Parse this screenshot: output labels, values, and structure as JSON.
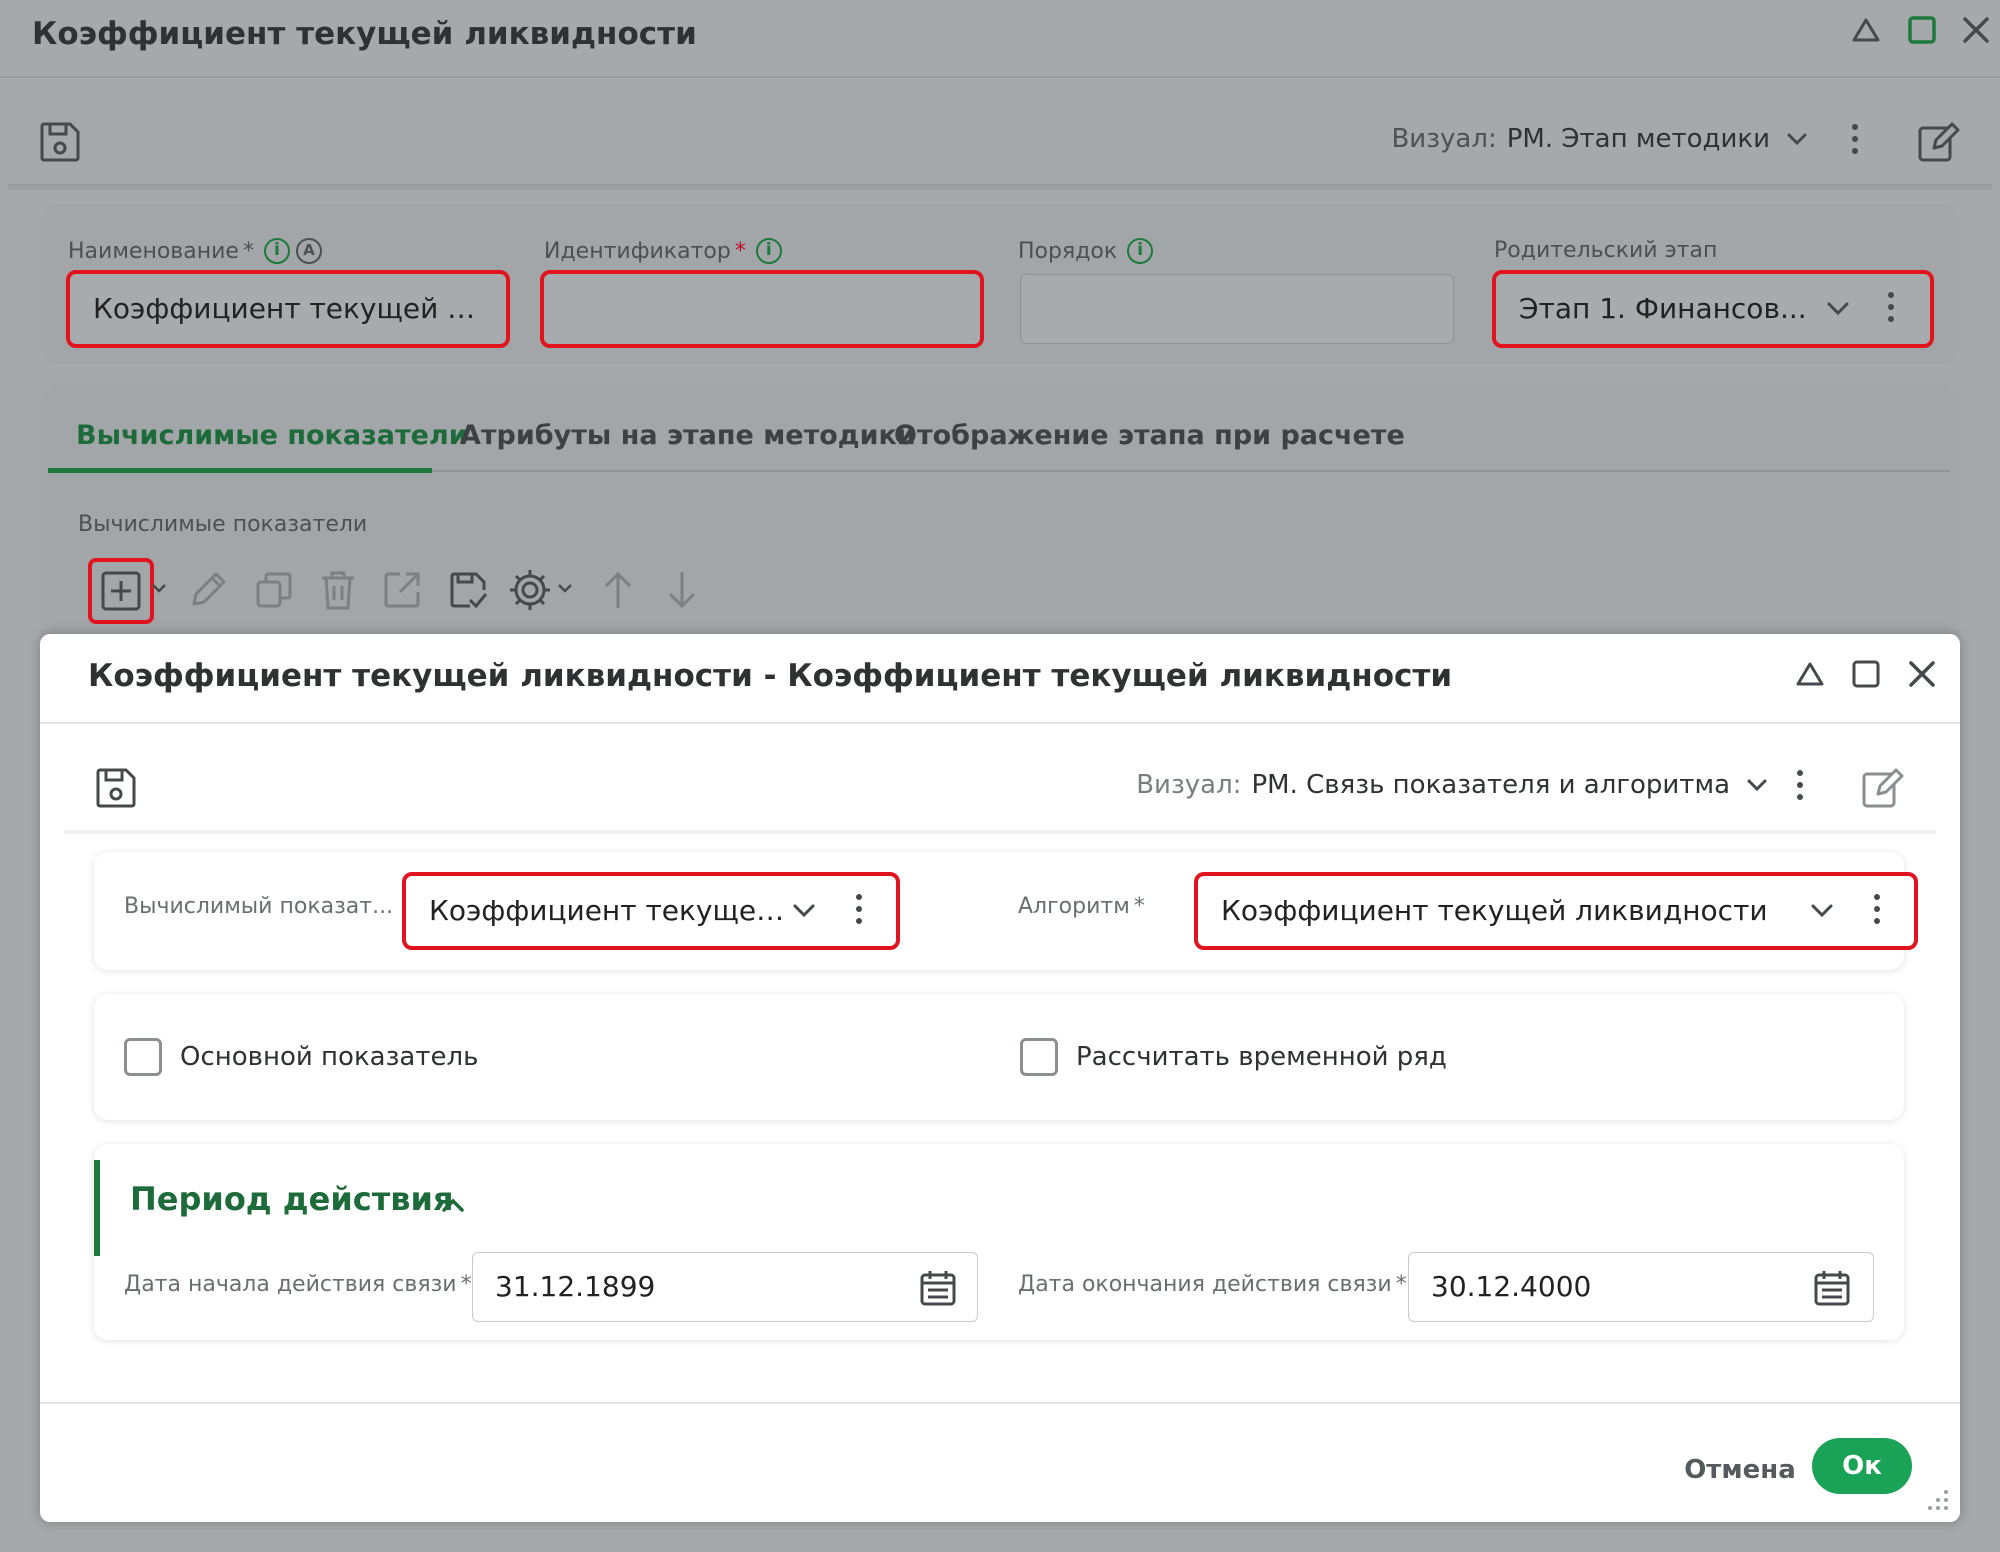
{
  "window": {
    "title": "Коэффициент текущей ликвидности",
    "visual_label": "Визуал:",
    "visual_value": "РМ. Этап методики"
  },
  "form": {
    "name": {
      "label": "Наименование",
      "required": "*",
      "value": "Коэффициент текущей ли..."
    },
    "identifier": {
      "label": "Идентификатор",
      "required": "*",
      "value": ""
    },
    "order": {
      "label": "Порядок",
      "value": ""
    },
    "parent_stage": {
      "label": "Родительский этап",
      "value": "Этап 1. Финансов..."
    }
  },
  "tabs": [
    {
      "label": "Вычислимые показатели"
    },
    {
      "label": "Атрибуты на этапе методики"
    },
    {
      "label": "Отображение этапа при расчете"
    }
  ],
  "section": {
    "label": "Вычислимые показатели"
  },
  "modal": {
    "title": "Коэффициент текущей ликвидности - Коэффициент текущей ликвидности",
    "visual_label": "Визуал:",
    "visual_value": "РМ. Связь показателя и алгоритма",
    "indicator": {
      "label": "Вычислимый показат...",
      "value": "Коэффициент текущей ликви..."
    },
    "algorithm": {
      "label": "Алгоритм",
      "required": "*",
      "value": "Коэффициент текущей ликвидности"
    },
    "checkbox_main": {
      "label": "Основной показатель",
      "checked": false
    },
    "checkbox_series": {
      "label": "Рассчитать временной ряд",
      "checked": false
    },
    "period": {
      "title": "Период действия",
      "start": {
        "label": "Дата начала действия связи",
        "required": "*",
        "value": "31.12.1899"
      },
      "end": {
        "label": "Дата окончания действия связи",
        "required": "*",
        "value": "30.12.4000"
      }
    },
    "buttons": {
      "cancel": "Отмена",
      "ok": "Ок"
    }
  },
  "colors": {
    "accent": "#1e7a3c",
    "ok_button": "#1aa357",
    "highlight": "#e0141f"
  },
  "icons": [
    "save-icon",
    "edit-icon",
    "add-icon",
    "pencil-icon",
    "copy-icon",
    "trash-icon",
    "export-icon",
    "import-icon",
    "gear-icon",
    "arrow-up-icon",
    "arrow-down-icon",
    "calendar-icon",
    "minimize-icon",
    "maximize-icon",
    "close-icon",
    "chevron-down-icon",
    "chevron-up-icon",
    "kebab-icon"
  ]
}
